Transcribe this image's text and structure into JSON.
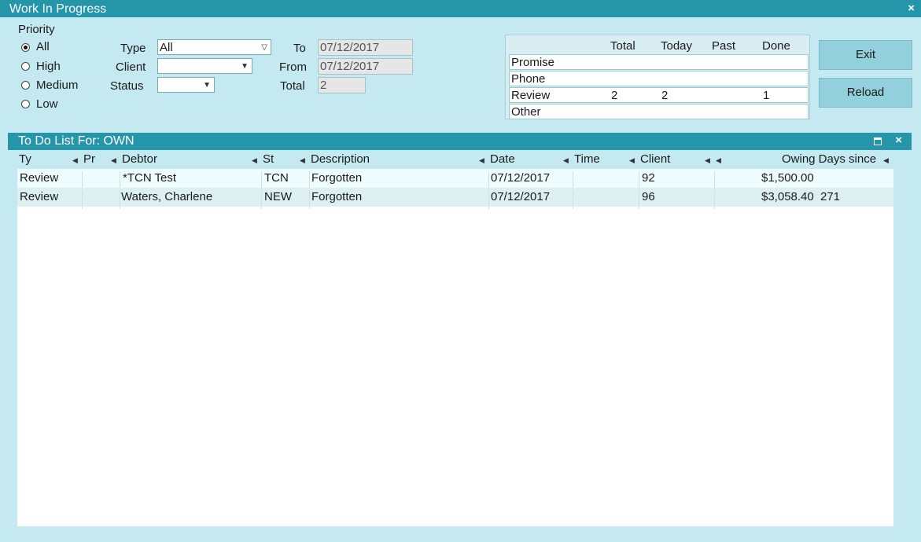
{
  "window": {
    "title": "Work In Progress",
    "close": "×"
  },
  "filters": {
    "priority_label": "Priority",
    "priority_options": [
      "All",
      "High",
      "Medium",
      "Low"
    ],
    "priority_selected": "All",
    "type_label": "Type",
    "type_value": "All",
    "client_label": "Client",
    "client_value": "",
    "status_label": "Status",
    "status_value": "",
    "to_label": "To",
    "to_value": "07/12/2017",
    "from_label": "From",
    "from_value": "07/12/2017",
    "total_label": "Total",
    "total_value": "2"
  },
  "summary": {
    "headers": [
      "Total",
      "Today",
      "Past",
      "Done"
    ],
    "rows": [
      {
        "label": "Promise",
        "total": "",
        "today": "",
        "past": "",
        "done": ""
      },
      {
        "label": "Phone",
        "total": "",
        "today": "",
        "past": "",
        "done": ""
      },
      {
        "label": "Review",
        "total": "2",
        "today": "2",
        "past": "",
        "done": "1"
      },
      {
        "label": "Other",
        "total": "",
        "today": "",
        "past": "",
        "done": ""
      }
    ]
  },
  "buttons": {
    "exit": "Exit",
    "reload": "Reload"
  },
  "todo": {
    "title_prefix": "To Do List For:",
    "owner": "OWN",
    "columns": [
      "Ty",
      "Pr",
      "Debtor",
      "St",
      "Description",
      "Date",
      "Time",
      "Client",
      "Owing Days since"
    ],
    "rows": [
      {
        "ty": "Review",
        "pr": "",
        "debtor": "*TCN Test",
        "st": "TCN",
        "description": "Forgotten",
        "date": "07/12/2017",
        "time": "",
        "client": "92",
        "owing": "$1,500.00",
        "days": ""
      },
      {
        "ty": "Review",
        "pr": "",
        "debtor": "Waters, Charlene",
        "st": "NEW",
        "description": "Forgotten",
        "date": "07/12/2017",
        "time": "",
        "client": "96",
        "owing": "$3,058.40",
        "days": "271"
      }
    ]
  },
  "colors": {
    "titlebar": "#2596a9",
    "background": "#c5e9f1",
    "row_a": "#eefcfd",
    "row_b": "#dcf0f2"
  }
}
